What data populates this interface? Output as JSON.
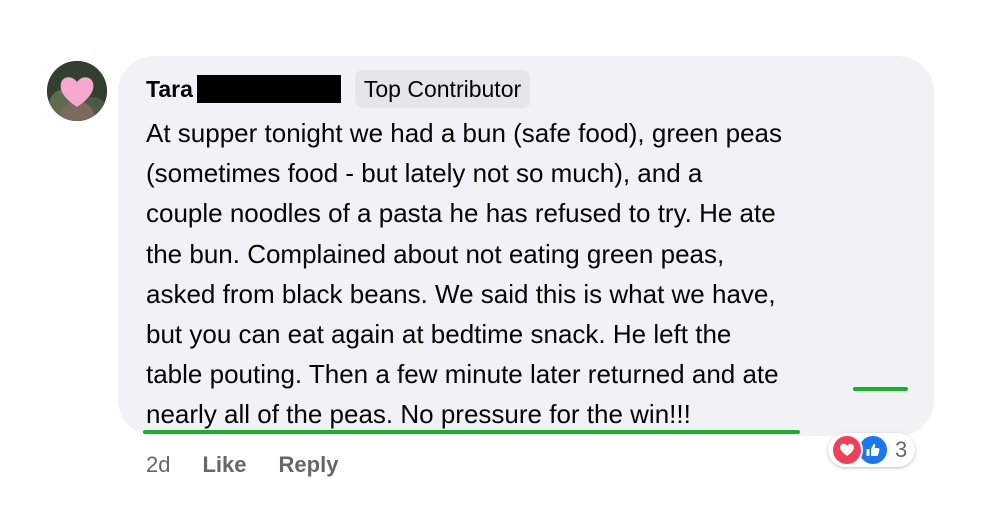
{
  "comment": {
    "author": "Tara",
    "badge": "Top Contributor",
    "lines": [
      "At supper tonight we had a bun (safe food), green peas",
      "(sometimes food - but lately not so much), and a",
      "couple noodles of a pasta he has refused to try. He ate",
      "the bun. Complained about not eating green peas,",
      "asked from black beans. We said this is what we have,",
      "but you can eat again at bedtime snack. He left the",
      "table pouting. Then a few minute later returned and ate",
      "nearly all of the peas. No pressure for the win!!!"
    ],
    "highlight_color": "#18b22a"
  },
  "actions": {
    "time": "2d",
    "like_label": "Like",
    "reply_label": "Reply"
  },
  "reactions": {
    "icons": [
      "heart-icon",
      "thumbs-up-icon"
    ],
    "count": "3",
    "love_color": "#f33e58",
    "like_color": "#1877f2"
  },
  "bubble_color": "#f0f2f5"
}
